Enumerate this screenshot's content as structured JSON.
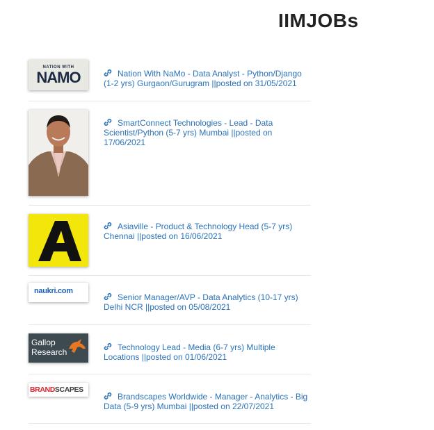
{
  "header": {
    "title": "IIMJOBs"
  },
  "logos": {
    "namo": {
      "top_text": "NATION WITH",
      "main_text": "NAMO"
    },
    "naukri": {
      "text": "naukri.com"
    },
    "gallop": {
      "line1": "Gallop",
      "line2": "Research"
    },
    "brandscapes": {
      "part1": "BRAND",
      "part2": "SCAPES"
    }
  },
  "jobs": [
    {
      "title": "Nation With NaMo - Data Analyst - Python/Django (1-2 yrs) Gurgaon/Gurugram ||posted on 31/05/2021",
      "logo": "nation-with-namo-logo"
    },
    {
      "title": "SmartConnect Technologies - Lead - Data Scientist/Python (5-7 yrs) Mumbai ||posted on 17/06/2021",
      "logo": "recruiter-photo"
    },
    {
      "title": "Asiaville - Product & Technology Head (5-7 yrs) Chennai ||posted on 16/06/2021",
      "logo": "asiaville-logo"
    },
    {
      "title": "Senior Manager/AVP - Data Analytics (10-17 yrs) Delhi NCR ||posted on 05/08/2021",
      "logo": "naukri-logo"
    },
    {
      "title": "Technology Lead - Media (6-7 yrs) Multiple Locations ||posted on 01/06/2021",
      "logo": "gallop-research-logo"
    },
    {
      "title": "Brandscapes Worldwide - Manager - Analytics - Big Data (5-9 yrs) Mumbai ||posted on 22/07/2021",
      "logo": "brandscapes-logo"
    }
  ],
  "colors": {
    "link": "#2a72b8",
    "title": "#222222",
    "divider": "#e6e6e6"
  }
}
